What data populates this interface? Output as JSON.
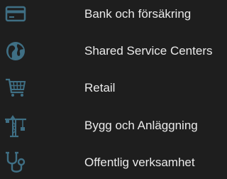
{
  "theme": {
    "background": "#1e1e1e",
    "icon_color": "#3f6f84",
    "text_color": "#eaeaea"
  },
  "menu": {
    "items": [
      {
        "icon": "credit-card-icon",
        "label": "Bank och försäkring"
      },
      {
        "icon": "globe-icon",
        "label": "Shared Service Centers"
      },
      {
        "icon": "shopping-cart-icon",
        "label": "Retail"
      },
      {
        "icon": "construction-crane-icon",
        "label": "Bygg och Anläggning"
      },
      {
        "icon": "stethoscope-icon",
        "label": "Offentlig verksamhet"
      }
    ]
  }
}
